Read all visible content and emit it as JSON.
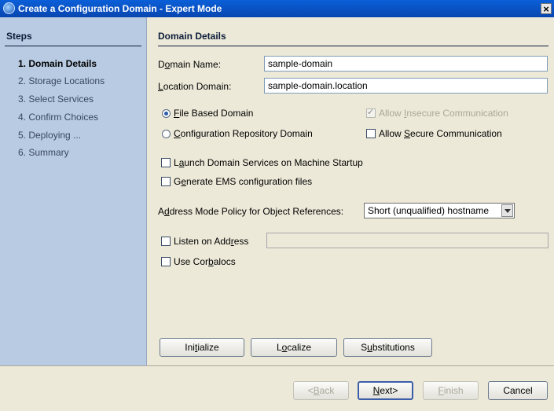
{
  "window": {
    "title": "Create a Configuration Domain - Expert Mode",
    "close_glyph": "×"
  },
  "steps": {
    "heading": "Steps",
    "items": [
      {
        "label": "1. Domain Details",
        "current": true
      },
      {
        "label": "2. Storage Locations"
      },
      {
        "label": "3. Select Services"
      },
      {
        "label": "4. Confirm Choices"
      },
      {
        "label": "5. Deploying ..."
      },
      {
        "label": "6. Summary"
      }
    ]
  },
  "details": {
    "heading": "Domain Details",
    "domain_name": {
      "label_pre": "D",
      "label_ul": "o",
      "label_post": "main Name:",
      "value": "sample-domain"
    },
    "location_domain": {
      "label_pre": "",
      "label_ul": "L",
      "label_post": "ocation Domain:",
      "value": "sample-domain.location"
    },
    "domain_type": {
      "file_based": {
        "pre": "",
        "ul": "F",
        "post": "ile Based Domain",
        "selected": true
      },
      "config_repo": {
        "pre": "",
        "ul": "C",
        "post": "onfiguration Repository Domain",
        "selected": false
      }
    },
    "allow_insecure": {
      "pre": "Allow ",
      "ul": "I",
      "post": "nsecure Communication",
      "checked": true,
      "enabled": false
    },
    "allow_secure": {
      "pre": "Allow ",
      "ul": "S",
      "post": "ecure Communication",
      "checked": false
    },
    "launch_services": {
      "pre": "L",
      "ul": "a",
      "post": "unch Domain Services on Machine Startup",
      "checked": false
    },
    "generate_ems": {
      "pre": "G",
      "ul": "e",
      "post": "nerate EMS configuration files",
      "checked": false
    },
    "address_mode": {
      "label_pre": "A",
      "label_ul": "d",
      "label_post": "dress Mode Policy for Object References:",
      "selected": "Short (unqualified) hostname"
    },
    "listen_on_address": {
      "pre": "Listen on Add",
      "ul": "r",
      "post": "ess",
      "checked": false,
      "value": ""
    },
    "use_corbalocs": {
      "pre": "Use Cor",
      "ul": "b",
      "post": "alocs",
      "checked": false
    }
  },
  "actions": {
    "initialize": {
      "pre": "Ini",
      "ul": "t",
      "post": "ialize"
    },
    "localize": {
      "pre": "L",
      "ul": "o",
      "post": "calize"
    },
    "substitutions": {
      "pre": "S",
      "ul": "u",
      "post": "bstitutions"
    }
  },
  "footer": {
    "back": {
      "pre": "<",
      "ul": "B",
      "post": "ack",
      "enabled": false
    },
    "next": {
      "pre": "",
      "ul": "N",
      "post": "ext>"
    },
    "finish": {
      "pre": "",
      "ul": "F",
      "post": "inish",
      "enabled": false
    },
    "cancel": {
      "label": "Cancel"
    }
  }
}
